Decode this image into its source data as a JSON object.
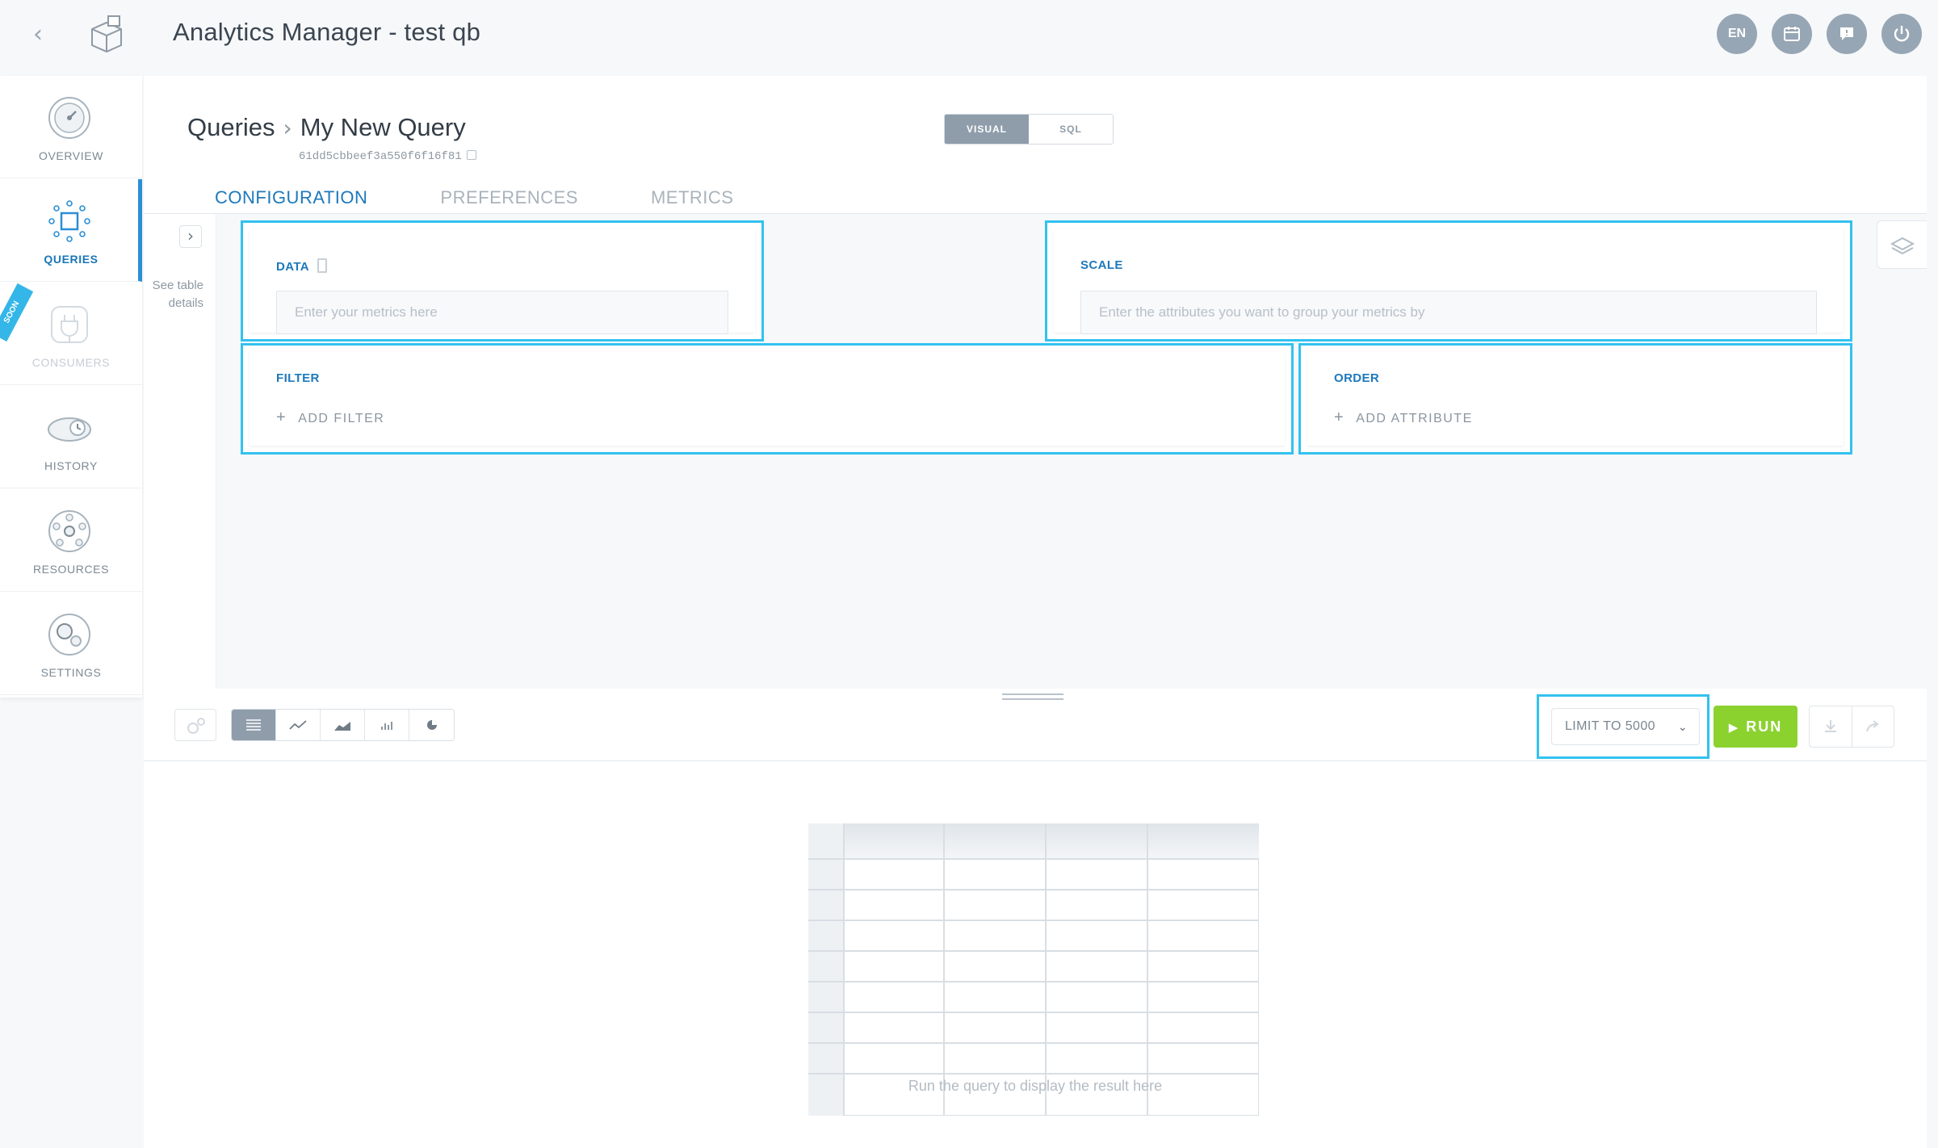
{
  "header": {
    "title": "Analytics Manager - test qb",
    "back_icon": "chevron-left-icon",
    "logo_icon": "box-logo-icon",
    "actions": [
      {
        "name": "language-button",
        "label": "EN"
      },
      {
        "name": "calendar-button",
        "icon": "calendar-icon"
      },
      {
        "name": "chat-button",
        "icon": "chat-icon"
      },
      {
        "name": "power-button",
        "icon": "power-icon"
      }
    ]
  },
  "sidebar": {
    "items": [
      {
        "label": "OVERVIEW",
        "icon": "gauge-icon",
        "state": "normal"
      },
      {
        "label": "QUERIES",
        "icon": "chip-icon",
        "state": "active"
      },
      {
        "label": "CONSUMERS",
        "icon": "plug-icon",
        "state": "disabled",
        "badge": "SOON"
      },
      {
        "label": "HISTORY",
        "icon": "timeline-icon",
        "state": "normal"
      },
      {
        "label": "RESOURCES",
        "icon": "network-icon",
        "state": "normal"
      },
      {
        "label": "SETTINGS",
        "icon": "gears-icon",
        "state": "normal"
      }
    ]
  },
  "page": {
    "breadcrumb_root": "Queries",
    "breadcrumb_current": "My New Query",
    "query_id": "61dd5cbbeef3a550f6f16f81",
    "mode_toggle": {
      "visual": "VISUAL",
      "sql": "SQL",
      "selected": "VISUAL"
    },
    "tabs": [
      {
        "label": "CONFIGURATION",
        "active": true
      },
      {
        "label": "PREFERENCES",
        "active": false
      },
      {
        "label": "METRICS",
        "active": false
      }
    ],
    "see_table_details": "See table details"
  },
  "config": {
    "data": {
      "title": "DATA",
      "placeholder": "Enter your metrics here"
    },
    "scale": {
      "title": "SCALE",
      "placeholder": "Enter the attributes you want to group your metrics by"
    },
    "filter": {
      "title": "FILTER",
      "add_label": "ADD FILTER"
    },
    "order": {
      "title": "ORDER",
      "add_label": "ADD ATTRIBUTE"
    }
  },
  "results": {
    "limit_label": "LIMIT TO 5000",
    "run_label": "RUN",
    "empty_message": "Run the query to display the result here",
    "viz_options": [
      "table",
      "line",
      "area",
      "bar",
      "pie"
    ],
    "selected_viz": "table"
  },
  "colors": {
    "accent": "#1d79bb",
    "highlight": "#32c2ef",
    "run": "#8bd22f",
    "toggle_active": "#8f9dab"
  }
}
